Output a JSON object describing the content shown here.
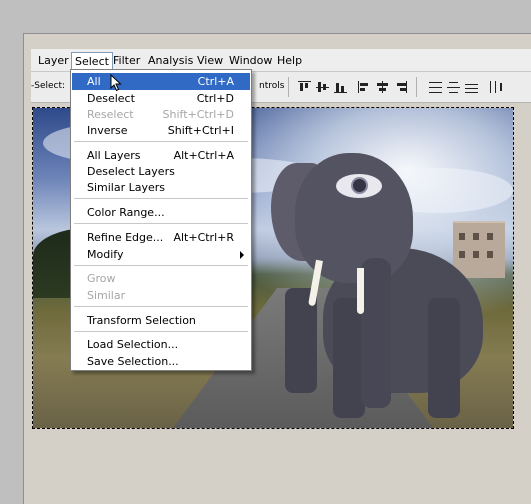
{
  "menubar": {
    "items": [
      "Layer",
      "Select",
      "Filter",
      "Analysis",
      "View",
      "Window",
      "Help"
    ]
  },
  "options_bar": {
    "auto_select_label": "-Select:",
    "show_controls_label": "ntrols"
  },
  "select_menu": {
    "items": [
      {
        "label": "All",
        "shortcut": "Ctrl+A",
        "state": "highlighted"
      },
      {
        "label": "Deselect",
        "shortcut": "Ctrl+D",
        "state": "enabled"
      },
      {
        "label": "Reselect",
        "shortcut": "Shift+Ctrl+D",
        "state": "disabled"
      },
      {
        "label": "Inverse",
        "shortcut": "Shift+Ctrl+I",
        "state": "enabled"
      },
      {
        "label": "All Layers",
        "shortcut": "Alt+Ctrl+A",
        "state": "enabled"
      },
      {
        "label": "Deselect Layers",
        "shortcut": "",
        "state": "enabled"
      },
      {
        "label": "Similar Layers",
        "shortcut": "",
        "state": "enabled"
      },
      {
        "label": "Color Range...",
        "shortcut": "",
        "state": "enabled"
      },
      {
        "label": "Refine Edge...",
        "shortcut": "Alt+Ctrl+R",
        "state": "enabled"
      },
      {
        "label": "Modify",
        "shortcut": "",
        "state": "enabled",
        "submenu": true
      },
      {
        "label": "Grow",
        "shortcut": "",
        "state": "disabled"
      },
      {
        "label": "Similar",
        "shortcut": "",
        "state": "disabled"
      },
      {
        "label": "Transform Selection",
        "shortcut": "",
        "state": "enabled"
      },
      {
        "label": "Load Selection...",
        "shortcut": "",
        "state": "enabled"
      },
      {
        "label": "Save Selection...",
        "shortcut": "",
        "state": "enabled"
      }
    ]
  },
  "colors": {
    "highlight": "#316ac5",
    "menu_bg": "#ffffff",
    "disabled_text": "#a6a6a6"
  },
  "icons": [
    "arrow-cursor-icon",
    "align-top-icon",
    "align-vcenter-icon",
    "align-bottom-icon",
    "align-left-icon",
    "align-hcenter-icon",
    "align-right-icon",
    "distribute-top-icon",
    "distribute-vcenter-icon",
    "distribute-bottom-icon",
    "distribute-left-icon",
    "submenu-arrow-icon"
  ]
}
